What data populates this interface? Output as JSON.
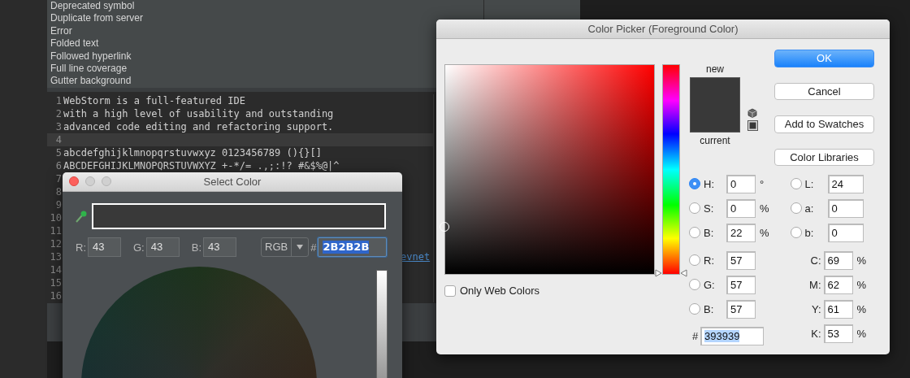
{
  "ide": {
    "color_keys": [
      "Deprecated symbol",
      "Duplicate from server",
      "Error",
      "Folded text",
      "Followed hyperlink",
      "Full line coverage",
      "Gutter background"
    ],
    "editor_lines": [
      {
        "number": "1",
        "text": "WebStorm is a full-featured IDE",
        "highlighted": false
      },
      {
        "number": "2",
        "text": "with a high level of usability and outstanding",
        "highlighted": false
      },
      {
        "number": "3",
        "text": "advanced code editing and refactoring support.",
        "highlighted": false
      },
      {
        "number": "4",
        "highlighted": true
      },
      {
        "number": "5",
        "text": "abcdefghijklmnopqrstuvwxyz 0123456789 (){}[]",
        "highlighted": false
      },
      {
        "number": "6",
        "text": "ABCDEFGHIJKLMNOPQRSTUVWXYZ +-*/= .,;:!? #&$%@|^",
        "highlighted": false
      },
      {
        "number": "7",
        "highlighted": false
      },
      {
        "number": "8",
        "highlighted": false
      },
      {
        "number": "9",
        "highlighted": false
      },
      {
        "number": "10",
        "highlighted": false
      },
      {
        "number": "11",
        "highlighted": false
      },
      {
        "number": "12",
        "highlighted": false
      },
      {
        "number": "13",
        "link": "evnet",
        "highlighted": false
      },
      {
        "number": "14",
        "highlighted": false
      },
      {
        "number": "15",
        "highlighted": false
      },
      {
        "number": "16",
        "highlighted": false
      }
    ]
  },
  "select_color": {
    "title": "Select Color",
    "fields": [
      {
        "label": "R:",
        "value": "43"
      },
      {
        "label": "G:",
        "value": "43"
      },
      {
        "label": "B:",
        "value": "43"
      }
    ],
    "mode": "RGB",
    "hex_prefix": "#",
    "hex": "2B2B2B"
  },
  "color_picker": {
    "title": "Color Picker (Foreground Color)",
    "new_label": "new",
    "current_label": "current",
    "hue_slider": {
      "level": 0
    },
    "only_web_colors": {
      "label": "Only Web Colors",
      "checked": false
    },
    "buttons": [
      {
        "label": "OK",
        "default": true
      },
      {
        "label": "Cancel",
        "default": false
      },
      {
        "label": "Add to Swatches",
        "default": false
      },
      {
        "label": "Color Libraries",
        "default": false
      }
    ],
    "hsb_fields": [
      {
        "label": "H:",
        "value": "0",
        "unit": "°",
        "selected": true
      },
      {
        "label": "S:",
        "value": "0",
        "unit": "%",
        "selected": false
      },
      {
        "label": "B:",
        "value": "22",
        "unit": "%",
        "selected": false
      }
    ],
    "rgb_fields": [
      {
        "label": "R:",
        "value": "57",
        "selected": false
      },
      {
        "label": "G:",
        "value": "57",
        "selected": false
      },
      {
        "label": "B:",
        "value": "57",
        "selected": false
      }
    ],
    "lab_fields": [
      {
        "label": "L:",
        "value": "24",
        "selected": false
      },
      {
        "label": "a:",
        "value": "0",
        "selected": false
      },
      {
        "label": "b:",
        "value": "0",
        "selected": false
      }
    ],
    "cmyk_fields": [
      {
        "label": "C:",
        "value": "69",
        "unit": "%"
      },
      {
        "label": "M:",
        "value": "62",
        "unit": "%"
      },
      {
        "label": "Y:",
        "value": "61",
        "unit": "%"
      },
      {
        "label": "K:",
        "value": "53",
        "unit": "%"
      }
    ],
    "hex_prefix": "#",
    "hex": "393939"
  }
}
